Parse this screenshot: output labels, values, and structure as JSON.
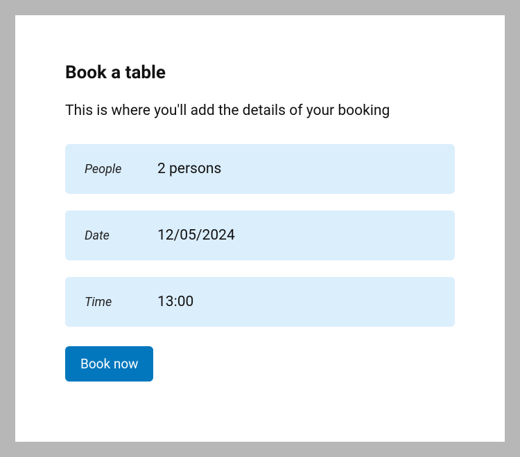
{
  "header": {
    "title": "Book a table",
    "subtitle": "This is where you'll add the details of your booking"
  },
  "fields": {
    "people": {
      "label": "People",
      "value": "2 persons"
    },
    "date": {
      "label": "Date",
      "value": "12/05/2024"
    },
    "time": {
      "label": "Time",
      "value": "13:00"
    }
  },
  "actions": {
    "submit_label": "Book now"
  },
  "colors": {
    "field_bg": "#dbeefc",
    "button_bg": "#0277bd"
  }
}
